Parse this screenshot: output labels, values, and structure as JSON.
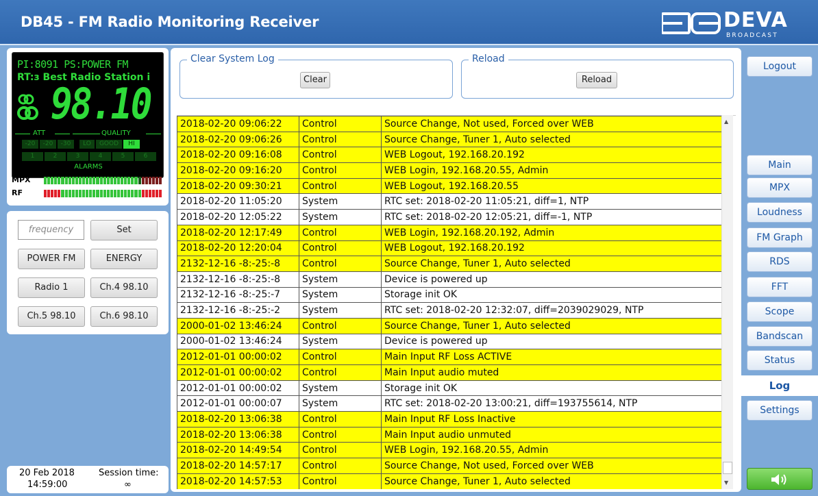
{
  "header": {
    "title": "DB45 - FM Radio Monitoring Receiver",
    "logo_main": "DEVA",
    "logo_sub": "BROADCAST"
  },
  "display": {
    "pi_ps": "PI:8091 PS:POWER FM",
    "rt": "RT:з Best Radio Station i",
    "frequency": "98.10",
    "att_label": "ATT",
    "quality_label": "QUALITY",
    "att_cells": [
      "-20",
      "-20",
      "-30"
    ],
    "quality_cells": [
      "LO",
      "GOOD",
      "HI"
    ],
    "active_quality": "HI",
    "alarm_cells": [
      "1",
      "2",
      "3",
      "4",
      "5",
      "6"
    ],
    "alarms_label": "ALARMS",
    "mpx_label": "MPX",
    "rf_label": "RF",
    "mpx_level": 0.8,
    "rf_level": 1.0
  },
  "presets": {
    "frequency_placeholder": "frequency",
    "set_label": "Set",
    "buttons": [
      "POWER FM",
      "ENERGY",
      "Radio 1",
      "Ch.4 98.10",
      "Ch.5 98.10",
      "Ch.6 98.10"
    ]
  },
  "session": {
    "date": "20 Feb 2018",
    "time": "14:59:00",
    "label": "Session time:",
    "value": "∞"
  },
  "log_controls": {
    "clear_legend": "Clear System Log",
    "clear_button": "Clear",
    "reload_legend": "Reload",
    "reload_button": "Reload"
  },
  "log": [
    {
      "time": "2018-02-20 09:06:22",
      "source": "Control",
      "message": "Source Change, Not used, Forced over WEB"
    },
    {
      "time": "2018-02-20 09:06:26",
      "source": "Control",
      "message": "Source Change, Tuner 1, Auto selected"
    },
    {
      "time": "2018-02-20 09:16:08",
      "source": "Control",
      "message": "WEB Logout, 192.168.20.192"
    },
    {
      "time": "2018-02-20 09:16:20",
      "source": "Control",
      "message": "WEB Login, 192.168.20.55, Admin"
    },
    {
      "time": "2018-02-20 09:30:21",
      "source": "Control",
      "message": "WEB Logout, 192.168.20.55"
    },
    {
      "time": "2018-02-20 11:05:20",
      "source": "System",
      "message": "RTC set: 2018-02-20 11:05:21, diff=1, NTP"
    },
    {
      "time": "2018-02-20 12:05:22",
      "source": "System",
      "message": "RTC set: 2018-02-20 12:05:21, diff=-1, NTP"
    },
    {
      "time": "2018-02-20 12:17:49",
      "source": "Control",
      "message": "WEB Login, 192.168.20.192, Admin"
    },
    {
      "time": "2018-02-20 12:20:04",
      "source": "Control",
      "message": "WEB Logout, 192.168.20.192"
    },
    {
      "time": "2132-12-16 -8:-25:-8",
      "source": "Control",
      "message": "Source Change, Tuner 1, Auto selected"
    },
    {
      "time": "2132-12-16 -8:-25:-8",
      "source": "System",
      "message": "Device is powered up"
    },
    {
      "time": "2132-12-16 -8:-25:-7",
      "source": "System",
      "message": "Storage init OK"
    },
    {
      "time": "2132-12-16 -8:-25:-2",
      "source": "System",
      "message": "RTC set: 2018-02-20 12:32:07, diff=2039029029, NTP"
    },
    {
      "time": "2000-01-02 13:46:24",
      "source": "Control",
      "message": "Source Change, Tuner 1, Auto selected"
    },
    {
      "time": "2000-01-02 13:46:24",
      "source": "System",
      "message": "Device is powered up"
    },
    {
      "time": "2012-01-01 00:00:02",
      "source": "Control",
      "message": "Main Input RF Loss ACTIVE"
    },
    {
      "time": "2012-01-01 00:00:02",
      "source": "Control",
      "message": "Main Input audio muted"
    },
    {
      "time": "2012-01-01 00:00:02",
      "source": "System",
      "message": "Storage init OK"
    },
    {
      "time": "2012-01-01 00:00:07",
      "source": "System",
      "message": "RTC set: 2018-02-20 13:00:21, diff=193755614, NTP"
    },
    {
      "time": "2018-02-20 13:06:38",
      "source": "Control",
      "message": "Main Input RF Loss Inactive"
    },
    {
      "time": "2018-02-20 13:06:38",
      "source": "Control",
      "message": "Main Input audio unmuted"
    },
    {
      "time": "2018-02-20 14:49:54",
      "source": "Control",
      "message": "WEB Login, 192.168.20.55, Admin"
    },
    {
      "time": "2018-02-20 14:57:17",
      "source": "Control",
      "message": "Source Change, Not used, Forced over WEB"
    },
    {
      "time": "2018-02-20 14:57:53",
      "source": "Control",
      "message": "Source Change, Tuner 1, Auto selected"
    }
  ],
  "nav": {
    "logout": "Logout",
    "items": [
      "Main",
      "MPX",
      "Loudness",
      "FM Graph",
      "RDS",
      "FFT",
      "Scope",
      "Bandscan",
      "Status"
    ],
    "active": "Log",
    "settings": "Settings",
    "sound_icon": "speaker-icon",
    "colors": {
      "control_row": "#ffff00",
      "accent": "#1d58a5",
      "header": "#3f78bd",
      "display_green": "#2fdc3a"
    }
  }
}
